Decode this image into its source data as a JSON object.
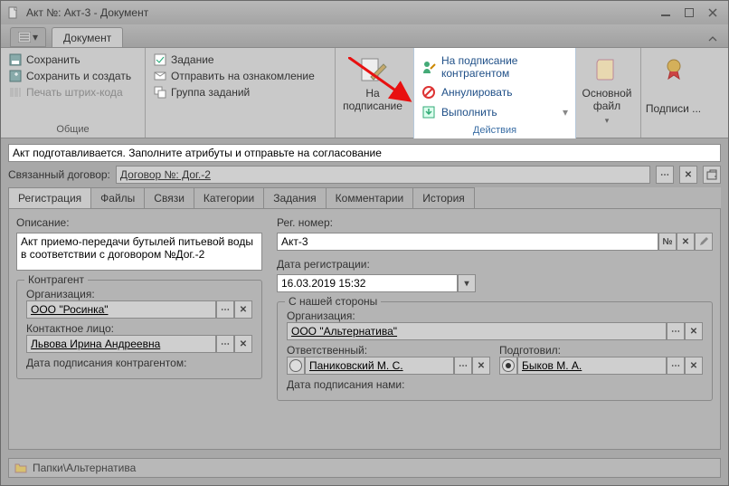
{
  "window": {
    "title": "Акт №: Акт-3 - Документ"
  },
  "ribbon": {
    "tab": "Документ",
    "general": {
      "label": "Общие",
      "save": "Сохранить",
      "save_create": "Сохранить и создать",
      "print_barcode": "Печать штрих-кода"
    },
    "tasks": {
      "label": "",
      "task": "Задание",
      "send_review": "Отправить на ознакомление",
      "task_group": "Группа заданий"
    },
    "sign_btn": "На подписание",
    "actions": {
      "label": "Действия",
      "sign_contr": "На подписание контрагентом",
      "cancel": "Аннулировать",
      "execute": "Выполнить"
    },
    "main_file": "Основной файл",
    "signatures": "Подписи ..."
  },
  "status_text": "Акт подготавливается. Заполните атрибуты и отправьте на согласование",
  "linked": {
    "label": "Связанный договор:",
    "value": "Договор №: Дог.-2"
  },
  "tabs": [
    "Регистрация",
    "Файлы",
    "Связи",
    "Категории",
    "Задания",
    "Комментарии",
    "История"
  ],
  "form": {
    "description_label": "Описание:",
    "description": "Акт приемо-передачи бутылей питьевой воды в соответствии с договором №Дог.-2",
    "reg_no_label": "Рег. номер:",
    "reg_no": "Акт-3",
    "reg_no_btn": "№",
    "reg_date_label": "Дата регистрации:",
    "reg_date": "16.03.2019 15:32",
    "contragent": {
      "title": "Контрагент",
      "org_label": "Организация:",
      "org": "ООО \"Росинка\"",
      "contact_label": "Контактное лицо:",
      "contact": "Львова Ирина Андреевна",
      "sign_date_label": "Дата подписания контрагентом:"
    },
    "ourside": {
      "title": "С нашей стороны",
      "org_label": "Организация:",
      "org": "ООО \"Альтернатива\"",
      "responsible_label": "Ответственный:",
      "responsible": "Паниковский М. С.",
      "prepared_label": "Подготовил:",
      "prepared": "Быков М. А.",
      "sign_date_label": "Дата подписания  нами:"
    }
  },
  "path": "Папки\\Альтернатива"
}
